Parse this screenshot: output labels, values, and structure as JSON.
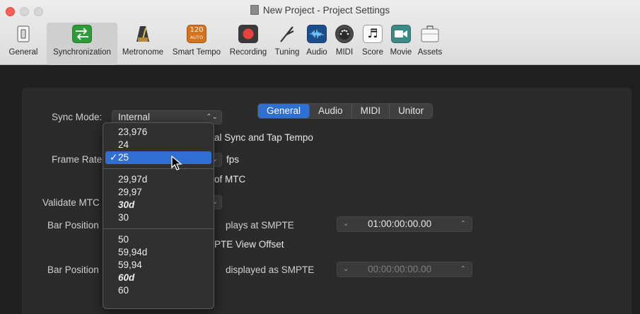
{
  "window": {
    "title": "New Project - Project Settings"
  },
  "toolbar": {
    "items": [
      {
        "label": "General",
        "icon": "switch-icon"
      },
      {
        "label": "Synchronization",
        "icon": "sync-arrows-icon",
        "active": true
      },
      {
        "label": "Metronome",
        "icon": "metronome-icon"
      },
      {
        "label": "Smart Tempo",
        "icon": "smart-tempo-icon",
        "badge_top": "120",
        "badge_bottom": "AUTO"
      },
      {
        "label": "Recording",
        "icon": "record-icon"
      },
      {
        "label": "Tuning",
        "icon": "tuning-fork-icon"
      },
      {
        "label": "Audio",
        "icon": "waveform-icon"
      },
      {
        "label": "MIDI",
        "icon": "midi-port-icon"
      },
      {
        "label": "Score",
        "icon": "note-icon"
      },
      {
        "label": "Movie",
        "icon": "camera-icon"
      },
      {
        "label": "Assets",
        "icon": "briefcase-icon"
      }
    ]
  },
  "tabs": {
    "items": [
      "General",
      "Audio",
      "MIDI",
      "Unitor"
    ],
    "selected": "General"
  },
  "settings": {
    "sync_mode_label": "Sync Mode:",
    "sync_mode_value": "Internal",
    "tap_tempo_text": "al Sync and Tap Tempo",
    "frame_rate_label": "Frame Rate",
    "fps_label": "fps",
    "mtc_text": "of MTC",
    "validate_mtc_label": "Validate MTC",
    "bar_position_label": "Bar Position",
    "plays_at_smpte": "plays at SMPTE",
    "smpte_view_offset": "PTE View Offset",
    "bar_position_label2": "Bar Position",
    "displayed_as_smpte": "displayed as SMPTE",
    "smpte_value1": "01:00:00:00.00",
    "smpte_value2": "00:00:00:00.00"
  },
  "frame_rate_menu": {
    "group1": [
      "23,976",
      "24"
    ],
    "selected": "25",
    "group2": [
      "29,97d",
      "29,97"
    ],
    "group2_bold": "30d",
    "group2_end": "30",
    "group3": [
      "50",
      "59,94d",
      "59,94"
    ],
    "group3_bold": "60d",
    "group3_end": "60"
  },
  "colors": {
    "accent": "#2f6fd4",
    "record_red": "#e8423c",
    "smart_tempo_orange": "#d2731f"
  }
}
